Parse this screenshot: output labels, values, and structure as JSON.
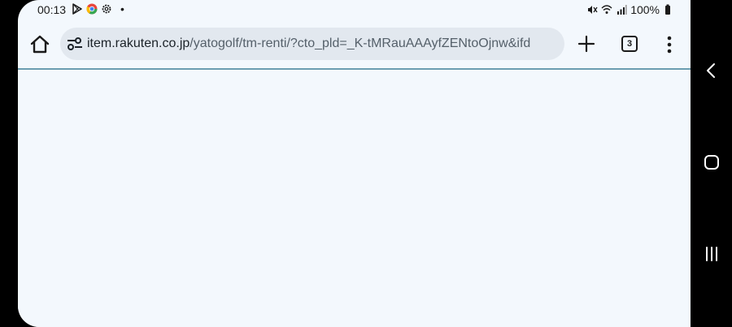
{
  "status_bar": {
    "time": "00:13",
    "battery": "100%",
    "icons": [
      "play-store-icon",
      "chrome-icon",
      "settings-icon",
      "mute-icon",
      "wifi-icon",
      "signal-icon",
      "battery-icon"
    ]
  },
  "browser": {
    "url_host": "item.rakuten.co.jp",
    "url_path": "/yatogolf/tm-renti/?cto_pld=_K-tMRauAAAyfZENtoOjnw&ifd",
    "tab_count": "3"
  },
  "colors": {
    "page_background": "#f3f8fd",
    "omnibox_background": "#e2e8ef",
    "progress_line": "#6b9db1"
  }
}
